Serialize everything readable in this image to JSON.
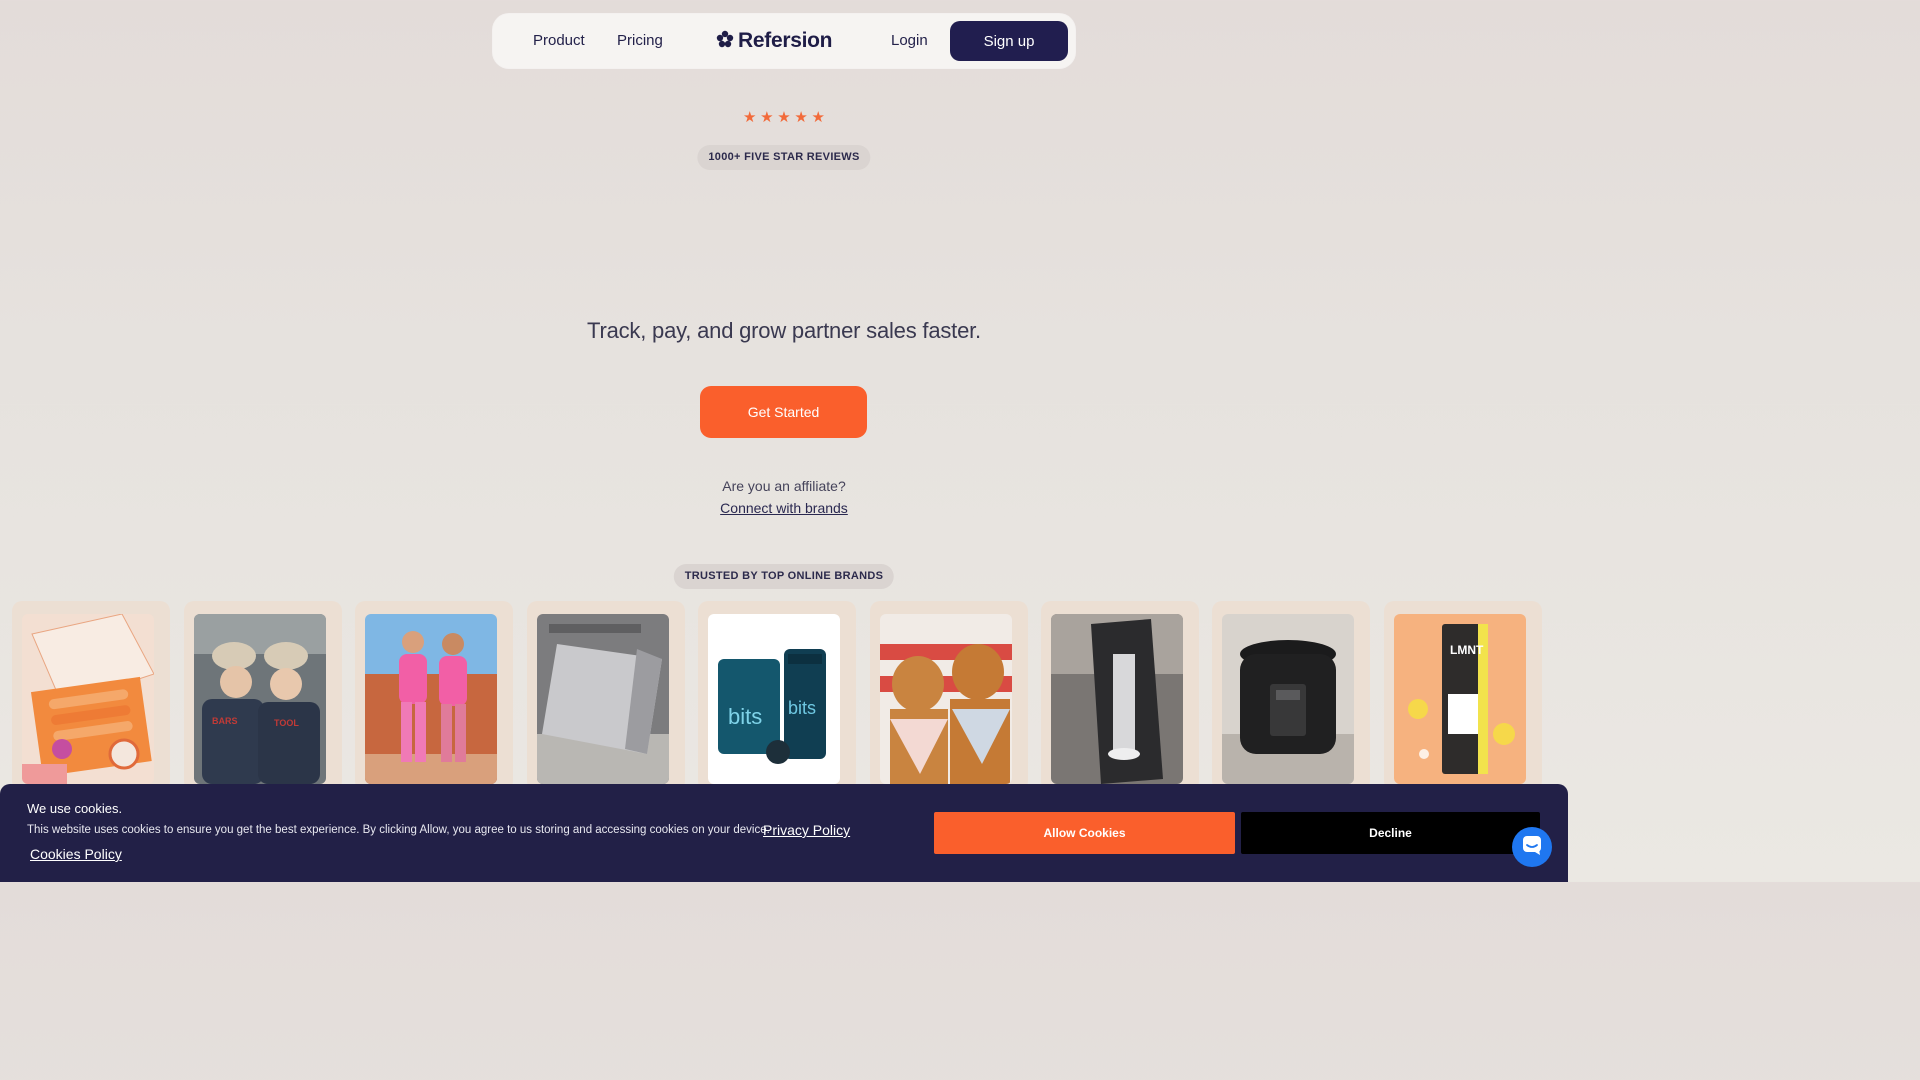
{
  "nav": {
    "product_label": "Product",
    "pricing_label": "Pricing",
    "logo_text": "Refersion",
    "login_label": "Login",
    "signup_label": "Sign up"
  },
  "reviews": {
    "stars": [
      "★",
      "★",
      "★",
      "★",
      "★"
    ],
    "rating": 5,
    "badge": "1000+ FIVE STAR REVIEWS"
  },
  "hero": {
    "tagline": "Track, pay, and grow partner sales faster.",
    "cta_label": "Get Started",
    "affiliate_question": "Are you an affiliate?",
    "affiliate_link": "Connect with brands"
  },
  "trusted": {
    "badge": "TRUSTED BY TOP ONLINE BRANDS",
    "cards": [
      {
        "name": "brand-card-orange-box"
      },
      {
        "name": "brand-card-barstool"
      },
      {
        "name": "brand-card-pink-activewear"
      },
      {
        "name": "brand-card-dermalogica"
      },
      {
        "name": "brand-card-energybits"
      },
      {
        "name": "brand-card-dogs"
      },
      {
        "name": "brand-card-studio-pro"
      },
      {
        "name": "brand-card-pressure-cooker"
      },
      {
        "name": "brand-card-lmnt"
      }
    ]
  },
  "cookie": {
    "title": "We use cookies.",
    "text": "This website uses cookies to ensure you get the best experience. By clicking Allow, you agree to us storing and accessing cookies on your device.",
    "privacy_link": "Privacy Policy",
    "cookies_policy_link": "Cookies Policy",
    "allow_label": "Allow Cookies",
    "decline_label": "Decline"
  },
  "colors": {
    "accent": "#fa5f2c",
    "navy": "#211e4f",
    "banner": "#222047",
    "chat": "#1f77f0"
  },
  "icons": {
    "logo": "refersion-logo-icon",
    "chat": "chat-bubble-icon"
  }
}
